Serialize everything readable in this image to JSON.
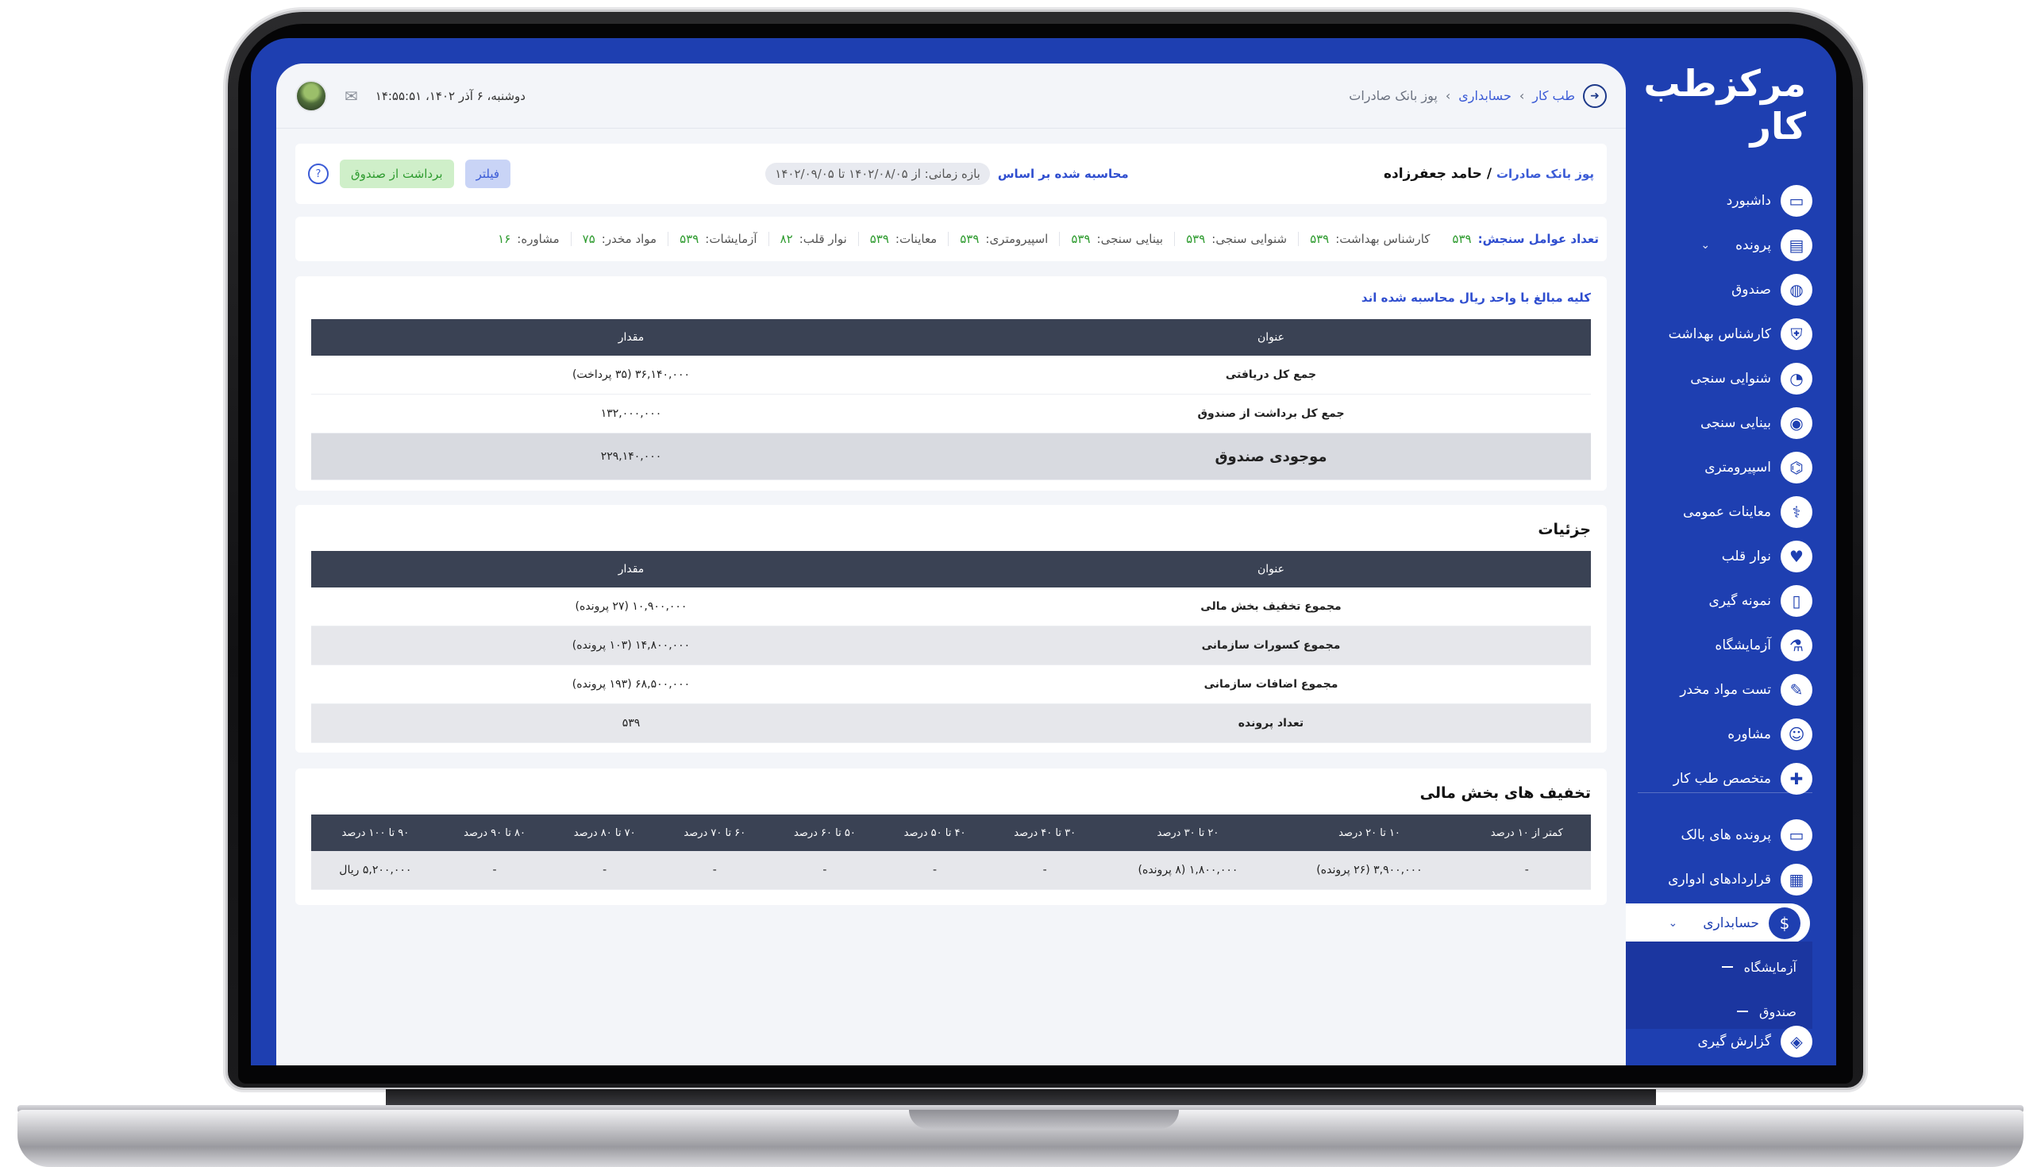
{
  "sidebar": {
    "logo": "مرکزطب کار",
    "items": [
      {
        "label": "داشبورد",
        "icon": "inbox-icon",
        "glyph": "▭"
      },
      {
        "label": "پرونده",
        "icon": "folder-icon",
        "glyph": "▤"
      },
      {
        "label": "صندوق",
        "icon": "cash-icon",
        "glyph": "◍"
      },
      {
        "label": "کارشناس بهداشت",
        "icon": "shield-icon",
        "glyph": "⛨"
      },
      {
        "label": "شنوایی سنجی",
        "icon": "ear-icon",
        "glyph": "◔"
      },
      {
        "label": "بینایی سنجی",
        "icon": "eye-icon",
        "glyph": "◉"
      },
      {
        "label": "اسپیرومتری",
        "icon": "lungs-icon",
        "glyph": "⌬"
      },
      {
        "label": "معاینات عمومی",
        "icon": "stethoscope-icon",
        "glyph": "⚕"
      },
      {
        "label": "نوار قلب",
        "icon": "heart-icon",
        "glyph": "♥"
      },
      {
        "label": "نمونه گیری",
        "icon": "tube-icon",
        "glyph": "▯"
      },
      {
        "label": "آزمایشگاه",
        "icon": "flask-icon",
        "glyph": "⚗"
      },
      {
        "label": "تست مواد مخدر",
        "icon": "syringe-icon",
        "glyph": "✎"
      },
      {
        "label": "مشاوره",
        "icon": "counselor-icon",
        "glyph": "☺"
      },
      {
        "label": "متخصص طب کار",
        "icon": "doctor-icon",
        "glyph": "✚"
      }
    ],
    "items2": [
      {
        "label": "پرونده های بالک",
        "icon": "archive-icon",
        "glyph": "▭"
      },
      {
        "label": "قراردادهای ادواری",
        "icon": "contract-icon",
        "glyph": "▦"
      }
    ],
    "active": {
      "label": "حسابداری",
      "icon": "dollar-icon",
      "glyph": "$"
    },
    "sub": [
      {
        "label": "آزمایشگاه"
      },
      {
        "label": "صندوق"
      }
    ],
    "last": {
      "label": "گزارش گیری",
      "icon": "layers-icon",
      "glyph": "◈"
    }
  },
  "topbar": {
    "crumb1": "طب کار",
    "crumb2": "حسابداری",
    "crumb3": "پوز بانک صادرات",
    "datetime": "دوشنبه، ۶ آذر ۱۴۰۲، ۱۴:۵۵:۵۱"
  },
  "header": {
    "link": "پوز بانک صادرات",
    "sep": "/",
    "name": "حامد جعفرزاده",
    "calc_label": "محاسبه شده بر اساس",
    "range": "بازه زمانی: از ۱۴۰۲/۰۸/۰۵ تا ۱۴۰۲/۰۹/۰۵",
    "filter": "فیلتر",
    "withdraw": "برداشت از صندوق"
  },
  "stats": {
    "title": "تعداد عوامل سنجش:",
    "total": "۵۳۹",
    "items": [
      {
        "label": "کارشناس بهداشت:",
        "value": "۵۳۹"
      },
      {
        "label": "شنوایی سنجی:",
        "value": "۵۳۹"
      },
      {
        "label": "بینایی سنجی:",
        "value": "۵۳۹"
      },
      {
        "label": "اسپیرومتری:",
        "value": "۵۳۹"
      },
      {
        "label": "معاینات:",
        "value": "۵۳۹"
      },
      {
        "label": "نوار قلب:",
        "value": "۸۲"
      },
      {
        "label": "آزمایشات:",
        "value": "۵۳۹"
      },
      {
        "label": "مواد مخدر:",
        "value": "۷۵"
      },
      {
        "label": "مشاوره:",
        "value": "۱۶"
      }
    ]
  },
  "summary": {
    "note": "کلیه مبالغ با واحد ریال محاسبه شده اند",
    "col_title": "عنوان",
    "col_value": "مقدار",
    "rows": [
      {
        "title": "جمع کل دریافتی",
        "value": "۳۶,۱۴۰,۰۰۰ (۳۵ پرداخت)"
      },
      {
        "title": "جمع کل برداشت از صندوق",
        "value": "۱۳۲,۰۰۰,۰۰۰"
      }
    ],
    "total": {
      "title": "موجودی صندوق",
      "value": "۲۲۹,۱۴۰,۰۰۰"
    }
  },
  "details": {
    "title": "جزئیات",
    "col_title": "عنوان",
    "col_value": "مقدار",
    "rows": [
      {
        "title": "مجموع تخفیف بخش مالی",
        "value": "۱۰,۹۰۰,۰۰۰ (۲۷ پرونده)"
      },
      {
        "title": "مجموع کسورات سازمانی",
        "value": "۱۴,۸۰۰,۰۰۰ (۱۰۳ پرونده)"
      },
      {
        "title": "مجموع اضافات سازمانی",
        "value": "۶۸,۵۰۰,۰۰۰ (۱۹۳ پرونده)"
      },
      {
        "title": "تعداد پرونده",
        "value": "۵۳۹"
      }
    ]
  },
  "discounts": {
    "title": "تخفیف های بخش مالی",
    "headers": [
      "کمتر از ۱۰ درصد",
      "۱۰ تا ۲۰ درصد",
      "۲۰ تا ۳۰ درصد",
      "۳۰ تا ۴۰ درصد",
      "۴۰ تا ۵۰ درصد",
      "۵۰ تا ۶۰ درصد",
      "۶۰ تا ۷۰ درصد",
      "۷۰ تا ۸۰ درصد",
      "۸۰ تا ۹۰ درصد",
      "۹۰ تا ۱۰۰ درصد"
    ],
    "values": [
      "-",
      "۳,۹۰۰,۰۰۰ (۲۶ پرونده)",
      "۱,۸۰۰,۰۰۰ (۸ پرونده)",
      "-",
      "-",
      "-",
      "-",
      "-",
      "-",
      "۵,۲۰۰,۰۰۰ ریال"
    ]
  }
}
